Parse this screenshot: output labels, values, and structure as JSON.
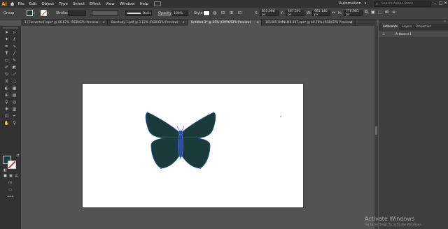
{
  "app": {
    "logo": "Ai"
  },
  "menu": [
    "File",
    "Edit",
    "Object",
    "Type",
    "Select",
    "Effect",
    "View",
    "Window",
    "Help"
  ],
  "workspace": "Automation",
  "search": {
    "placeholder": "Search Adobe Stock"
  },
  "window_controls": [
    "–",
    "□",
    "✕"
  ],
  "control_bar": {
    "selection_label": "Group",
    "stroke_label": "Stroke:",
    "brush_label": "Basic",
    "opacity_label": "Opacity:",
    "opacity_value": "100%",
    "style_label": "Style:",
    "x_label": "X:",
    "x_value": "855.066 px",
    "y_label": "Y:",
    "y_value": "467.591 px",
    "w_label": "W:",
    "w_value": "981.146 px",
    "h_label": "H:",
    "h_value": "776.981 px"
  },
  "tabs": [
    {
      "label": "1 [Converted].eps* @ 66.67% (RGB/GPU Preview)",
      "active": false
    },
    {
      "label": "Bacstudy 1.pdf @ 3.12% (RGB/GPU Preview)",
      "active": false
    },
    {
      "label": "Untitled-3* @ 25% (CMYK/GPU Preview)",
      "active": true
    },
    {
      "label": "101485-OMNLM8-397.eps* @ 40.78% (RGB/GPU Preview)",
      "active": false
    }
  ],
  "tab_close": "×",
  "panel": {
    "tabs": [
      "Artboards",
      "Layers",
      "Properties"
    ],
    "rows": [
      {
        "number": "1",
        "name": "Artboard 1"
      }
    ]
  },
  "colors": {
    "butterfly_fill": "#1b3a3a",
    "butterfly_stroke": "#3a6ad6",
    "selection": "#4a7cff",
    "stroke_none": "#e0302a"
  },
  "watermark": {
    "title": "Activate Windows",
    "subtitle": "Go to Settings to activate Windows."
  },
  "icons": [
    "selection-tool",
    "direct-selection-tool",
    "magic-wand-tool",
    "lasso-tool",
    "pen-tool",
    "type-tool",
    "line-tool",
    "rectangle-tool",
    "paintbrush-tool",
    "pencil-tool",
    "shaper-tool",
    "eraser-tool",
    "rotate-tool",
    "scale-tool",
    "width-tool",
    "free-transform-tool",
    "shape-builder-tool",
    "perspective-tool",
    "mesh-tool",
    "gradient-tool",
    "eyedropper-tool",
    "blend-tool",
    "symbol-sprayer-tool",
    "graph-tool",
    "artboard-tool",
    "slice-tool",
    "hand-tool",
    "zoom-tool"
  ]
}
